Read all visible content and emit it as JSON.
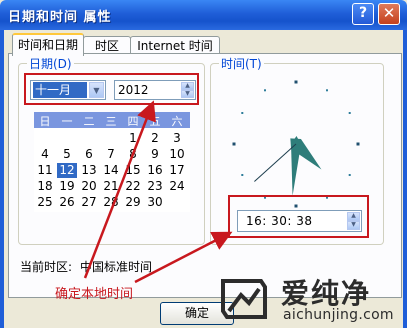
{
  "window": {
    "title": "日期和时间 属性",
    "help_glyph": "?",
    "close_glyph": "✕"
  },
  "tabs": [
    {
      "label": "时间和日期",
      "active": true
    },
    {
      "label": "时区",
      "active": false
    },
    {
      "label": "Internet 时间",
      "active": false
    }
  ],
  "date_group": {
    "label": "日期(D)",
    "month": "十一月",
    "year": "2012",
    "weekdays": [
      "日",
      "一",
      "二",
      "三",
      "四",
      "五",
      "六"
    ],
    "weeks": [
      [
        "",
        "",
        "",
        "",
        "1",
        "2",
        "3"
      ],
      [
        "4",
        "5",
        "6",
        "7",
        "8",
        "9",
        "10"
      ],
      [
        "11",
        "12",
        "13",
        "14",
        "15",
        "16",
        "17"
      ],
      [
        "18",
        "19",
        "20",
        "21",
        "22",
        "23",
        "24"
      ],
      [
        "25",
        "26",
        "27",
        "28",
        "29",
        "30",
        ""
      ]
    ],
    "selected_day": "12"
  },
  "time_group": {
    "label": "时间(T)",
    "value": "16: 30: 38",
    "clock": {
      "hour": 16,
      "minute": 30,
      "second": 38
    }
  },
  "timezone": {
    "label": "当前时区:",
    "value": "中国标准时间"
  },
  "annotation": {
    "text": "确定本地时间",
    "color": "#C8181E"
  },
  "buttons": {
    "ok": "确定"
  },
  "watermark": {
    "brand": "爱纯净",
    "url": "aichunjing.com"
  },
  "colors": {
    "titlebar": "#1F5ED8",
    "selection": "#316AC5",
    "highlight": "#C8181E",
    "clock_hand": "#2E7D7A"
  }
}
